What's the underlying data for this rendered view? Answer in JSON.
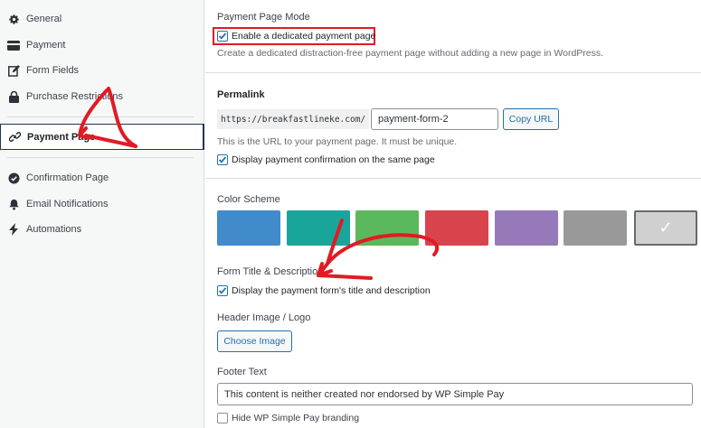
{
  "sidebar": {
    "items": [
      {
        "label": "General",
        "icon": "gear-icon"
      },
      {
        "label": "Payment",
        "icon": "credit-card-icon"
      },
      {
        "label": "Form Fields",
        "icon": "edit-icon"
      },
      {
        "label": "Purchase Restrictions",
        "icon": "lock-icon"
      },
      {
        "label": "Payment Page",
        "icon": "link-icon"
      },
      {
        "label": "Confirmation Page",
        "icon": "check-circle-icon"
      },
      {
        "label": "Email Notifications",
        "icon": "bell-icon"
      },
      {
        "label": "Automations",
        "icon": "bolt-icon"
      }
    ]
  },
  "main": {
    "payment_mode": {
      "title": "Payment Page Mode",
      "checkbox_label": "Enable a dedicated payment page",
      "checked": true,
      "description": "Create a dedicated distraction-free payment page without adding a new page in WordPress."
    },
    "permalink": {
      "title": "Permalink",
      "prefix": "https://breakfastlineke.com/",
      "value": "payment-form-2",
      "copy_label": "Copy URL",
      "description": "This is the URL to your payment page. It must be unique.",
      "confirm_label": "Display payment confirmation on the same page",
      "confirm_checked": true
    },
    "color_scheme": {
      "title": "Color Scheme",
      "swatches": [
        "#428bca",
        "#1aa59a",
        "#5cb85c",
        "#d9434e",
        "#9579b8",
        "#999999",
        "#d0d0d0"
      ],
      "selected_index": 6,
      "selected_mark": "✓"
    },
    "form_title": {
      "title": "Form Title & Description",
      "checkbox_label": "Display the payment form's title and description",
      "checked": true
    },
    "header_image": {
      "title": "Header Image / Logo",
      "button_label": "Choose Image"
    },
    "footer": {
      "title": "Footer Text",
      "value": "This content is neither created nor endorsed by WP Simple Pay",
      "hide_label": "Hide WP Simple Pay branding",
      "hide_checked": false
    }
  },
  "colors": {
    "accent": "#2271b1",
    "annotation_red": "#e01b24"
  }
}
